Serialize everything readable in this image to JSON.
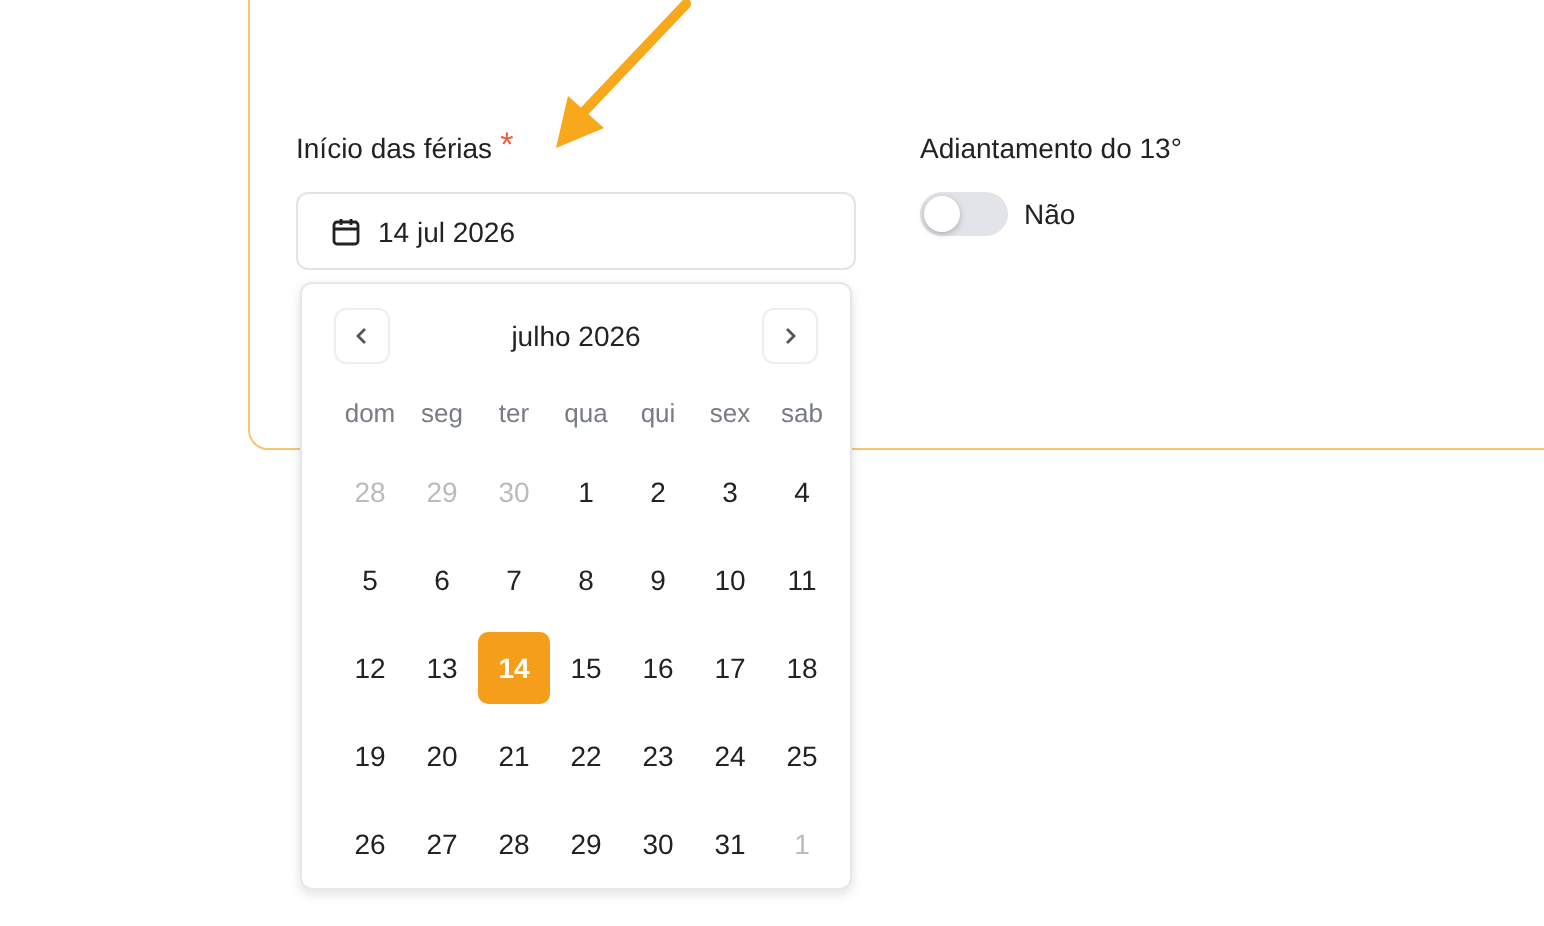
{
  "start_field": {
    "label": "Início das férias",
    "required_mark": "*",
    "value": "14 jul 2026"
  },
  "advance_field": {
    "label": "Adiantamento do 13°",
    "on": false,
    "state_text": "Não"
  },
  "calendar": {
    "month": "julho 2026",
    "weekdays": [
      "dom",
      "seg",
      "ter",
      "qua",
      "qui",
      "sex",
      "sab"
    ],
    "weeks": [
      [
        {
          "day": "28",
          "outside": true,
          "selected": false
        },
        {
          "day": "29",
          "outside": true,
          "selected": false
        },
        {
          "day": "30",
          "outside": true,
          "selected": false
        },
        {
          "day": "1",
          "outside": false,
          "selected": false
        },
        {
          "day": "2",
          "outside": false,
          "selected": false
        },
        {
          "day": "3",
          "outside": false,
          "selected": false
        },
        {
          "day": "4",
          "outside": false,
          "selected": false
        }
      ],
      [
        {
          "day": "5",
          "outside": false,
          "selected": false
        },
        {
          "day": "6",
          "outside": false,
          "selected": false
        },
        {
          "day": "7",
          "outside": false,
          "selected": false
        },
        {
          "day": "8",
          "outside": false,
          "selected": false
        },
        {
          "day": "9",
          "outside": false,
          "selected": false
        },
        {
          "day": "10",
          "outside": false,
          "selected": false
        },
        {
          "day": "11",
          "outside": false,
          "selected": false
        }
      ],
      [
        {
          "day": "12",
          "outside": false,
          "selected": false
        },
        {
          "day": "13",
          "outside": false,
          "selected": false
        },
        {
          "day": "14",
          "outside": false,
          "selected": true
        },
        {
          "day": "15",
          "outside": false,
          "selected": false
        },
        {
          "day": "16",
          "outside": false,
          "selected": false
        },
        {
          "day": "17",
          "outside": false,
          "selected": false
        },
        {
          "day": "18",
          "outside": false,
          "selected": false
        }
      ],
      [
        {
          "day": "19",
          "outside": false,
          "selected": false
        },
        {
          "day": "20",
          "outside": false,
          "selected": false
        },
        {
          "day": "21",
          "outside": false,
          "selected": false
        },
        {
          "day": "22",
          "outside": false,
          "selected": false
        },
        {
          "day": "23",
          "outside": false,
          "selected": false
        },
        {
          "day": "24",
          "outside": false,
          "selected": false
        },
        {
          "day": "25",
          "outside": false,
          "selected": false
        }
      ],
      [
        {
          "day": "26",
          "outside": false,
          "selected": false
        },
        {
          "day": "27",
          "outside": false,
          "selected": false
        },
        {
          "day": "28",
          "outside": false,
          "selected": false
        },
        {
          "day": "29",
          "outside": false,
          "selected": false
        },
        {
          "day": "30",
          "outside": false,
          "selected": false
        },
        {
          "day": "31",
          "outside": false,
          "selected": false
        },
        {
          "day": "1",
          "outside": true,
          "selected": false
        }
      ]
    ]
  }
}
